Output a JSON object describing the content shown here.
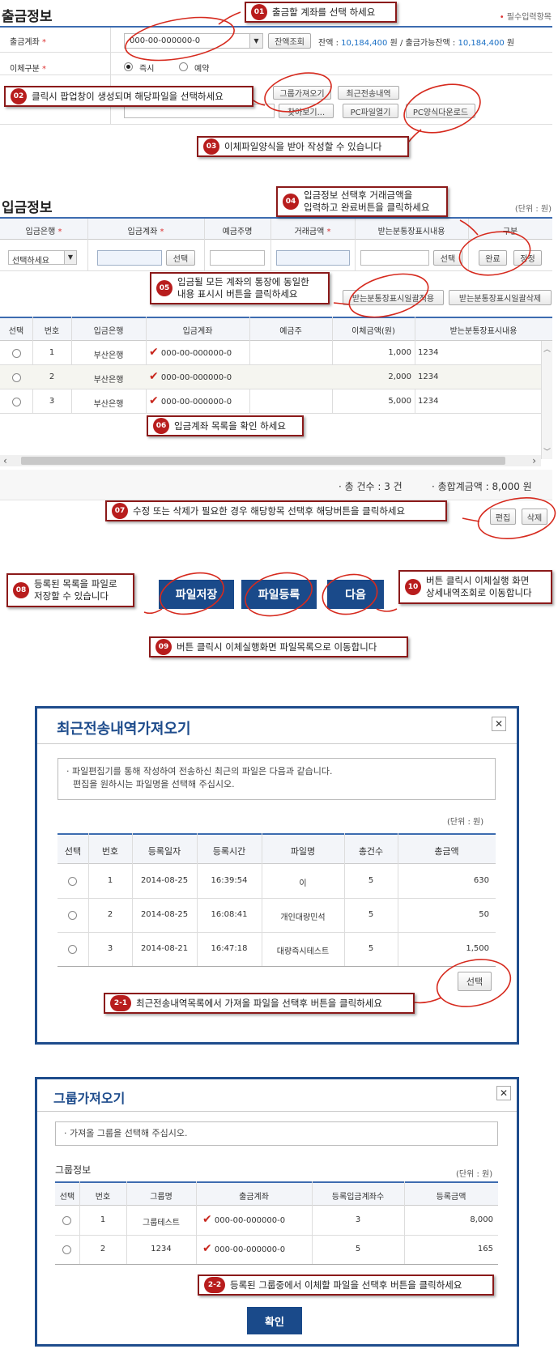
{
  "withdrawal": {
    "title": "출금정보",
    "required_note": "필수입력항목",
    "account_label": "출금계좌",
    "account_value": "000-00-000000-0",
    "balance_btn": "잔액조회",
    "balance_label": "잔액 :",
    "balance_value": "10,184,400",
    "balance_unit": "원 / 출금가능잔액 :",
    "available_value": "10,184,400",
    "available_unit": "원",
    "transfer_type_label": "이체구분",
    "radio_now": "즉시",
    "radio_reserve": "예약",
    "group_btn": "그룹가져오기",
    "recent_btn": "최근전송내역",
    "browse_btn": "찾아보기...",
    "pc_open_btn": "PC파일열기",
    "pc_download_btn": "PC양식다운로드"
  },
  "deposit": {
    "title": "입금정보",
    "unit": "(단위 : 원)",
    "headers": [
      "입금은행",
      "입금계좌",
      "예금주명",
      "거래금액",
      "받는분통장표시내용",
      "구분"
    ],
    "bank_select": "선택하세요",
    "select_btn": "선택",
    "select_btn2": "선택",
    "done_btn": "완료",
    "modify_btn": "정정",
    "bulk_apply_btn": "받는분통장표시일괄적용",
    "bulk_delete_btn": "받는분통장표시일괄삭제",
    "table_headers": [
      "선택",
      "번호",
      "입금은행",
      "입금계좌",
      "예금주",
      "이체금액(원)",
      "받는분통장표시내용"
    ],
    "rows": [
      {
        "no": "1",
        "bank": "부산은행",
        "account": "000-00-000000-0",
        "amount": "1,000",
        "memo": "1234"
      },
      {
        "no": "2",
        "bank": "부산은행",
        "account": "000-00-000000-0",
        "amount": "2,000",
        "memo": "1234"
      },
      {
        "no": "3",
        "bank": "부산은행",
        "account": "000-00-000000-0",
        "amount": "5,000",
        "memo": "1234"
      }
    ],
    "total_count_label": "· 총 건수 : 3 건",
    "total_amount_label": "· 총합계금액 : 8,000 원",
    "edit_btn": "편집",
    "delete_btn": "삭제"
  },
  "actions": {
    "save_file": "파일저장",
    "register_file": "파일등록",
    "next": "다음"
  },
  "callouts": {
    "c01": {
      "num": "01",
      "text": "출금할 계좌를 선택 하세요"
    },
    "c02": {
      "num": "02",
      "text": "클릭시 팝업창이 생성되며 해당파일을 선택하세요"
    },
    "c03": {
      "num": "03",
      "text": "이체파일양식을  받아 작성할 수 있습니다"
    },
    "c04": {
      "num": "04",
      "text1": "입금정보 선택후 거래금액을",
      "text2": "입력하고 완료버튼을 클릭하세요"
    },
    "c05": {
      "num": "05",
      "text1": "입금될 모든 계좌의 통장에 동일한",
      "text2": "내용 표시시 버튼을 클릭하세요"
    },
    "c06": {
      "num": "06",
      "text": "입금계좌 목록을 확인 하세요"
    },
    "c07": {
      "num": "07",
      "text": "수정 또는 삭제가 필요한 경우 해당항목 선택후 해당버튼을 클릭하세요"
    },
    "c08": {
      "num": "08",
      "text1": "등록된 목록을 파일로",
      "text2": "저장할 수 있습니다"
    },
    "c09": {
      "num": "09",
      "text": "버튼 클릭시 이체실행화면  파일목록으로 이동합니다"
    },
    "c10": {
      "num": "10",
      "text1": "버튼 클릭시 이체실행 화면",
      "text2": "상세내역조회로 이동합니다"
    },
    "c21": {
      "num": "2-1",
      "text": "최근전송내역목록에서 가져올  파일을 선택후 버튼을 클릭하세요"
    },
    "c22": {
      "num": "2-2",
      "text": "등록된 그룹중에서  이체할 파일을 선택후 버튼을 클릭하세요"
    }
  },
  "recent_popup": {
    "title": "최근전송내역가져오기",
    "close": "✕",
    "notice1": "· 파일편집기를 통해 작성하여 전송하신 최근의 파일은 다음과 같습니다.",
    "notice2": "편집을 원하시는 파일명을 선택해 주십시오.",
    "unit": "(단위 : 원)",
    "headers": [
      "선택",
      "번호",
      "등록일자",
      "등록시간",
      "파일명",
      "총건수",
      "총금액"
    ],
    "rows": [
      {
        "no": "1",
        "date": "2014-08-25",
        "time": "16:39:54",
        "name": "이",
        "count": "5",
        "amount": "630"
      },
      {
        "no": "2",
        "date": "2014-08-25",
        "time": "16:08:41",
        "name": "개인대량민석",
        "count": "5",
        "amount": "50"
      },
      {
        "no": "3",
        "date": "2014-08-21",
        "time": "16:47:18",
        "name": "대량즉시테스트",
        "count": "5",
        "amount": "1,500"
      }
    ],
    "select_btn": "선택"
  },
  "group_popup": {
    "title": "그룹가져오기",
    "close": "✕",
    "notice": "· 가져올 그룹을 선택해 주십시오.",
    "section": "그룹정보",
    "unit": "(단위 : 원)",
    "headers": [
      "선택",
      "번호",
      "그룹명",
      "출금계좌",
      "등록입금계좌수",
      "등록금액"
    ],
    "rows": [
      {
        "no": "1",
        "name": "그룹테스트",
        "account": "000-00-000000-0",
        "count": "3",
        "amount": "8,000"
      },
      {
        "no": "2",
        "name": "1234",
        "account": "000-00-000000-0",
        "count": "5",
        "amount": "165"
      }
    ],
    "confirm_btn": "확인"
  }
}
